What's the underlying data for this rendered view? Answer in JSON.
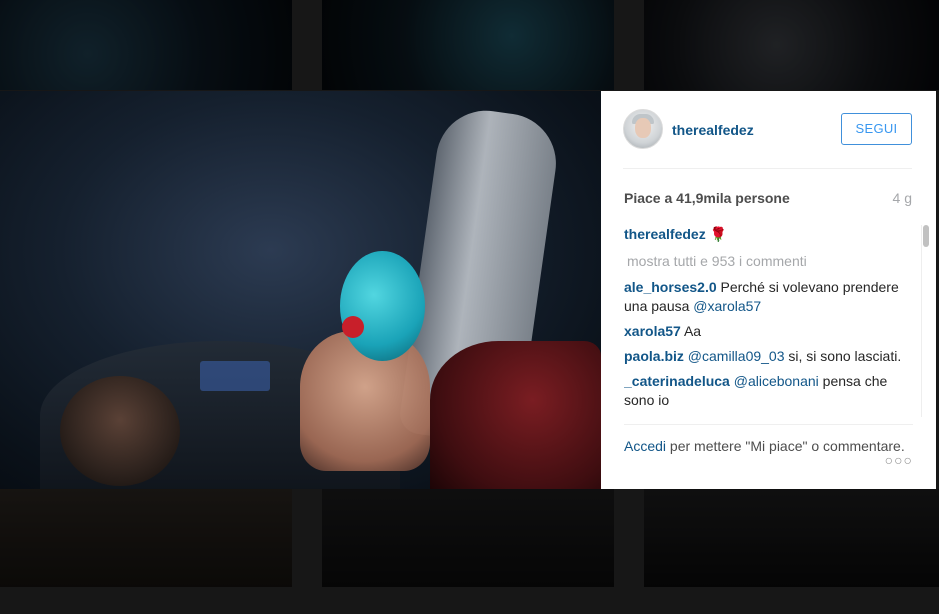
{
  "post": {
    "username": "therealfedez",
    "follow_label": "SEGUI",
    "likes_text": "Piace a 41,9mila persone",
    "age": "4 g",
    "caption_user": "therealfedez",
    "caption_text": "🌹",
    "show_comments": "mostra tutti e 953 i commenti",
    "comments": [
      {
        "user": "ale_horses2.0",
        "text": "Perché si volevano prendere una pausa",
        "mention": "@xarola57",
        "after": ""
      },
      {
        "user": "xarola57",
        "text": "Aa",
        "mention": "",
        "after": ""
      },
      {
        "user": "paola.biz",
        "text": "",
        "mention": "@camilla09_03",
        "after": "si, si sono lasciati."
      },
      {
        "user": "_caterinadeluca",
        "text": "",
        "mention": "@alicebonani",
        "after": "pensa che sono io"
      }
    ],
    "footer_login": "Accedi",
    "footer_text": "per mettere \"Mi piace\" o commentare.",
    "more_options": "○○○"
  },
  "icons": {
    "avatar": "user-avatar",
    "rose": "rose-emoji",
    "more": "more-options-icon"
  }
}
